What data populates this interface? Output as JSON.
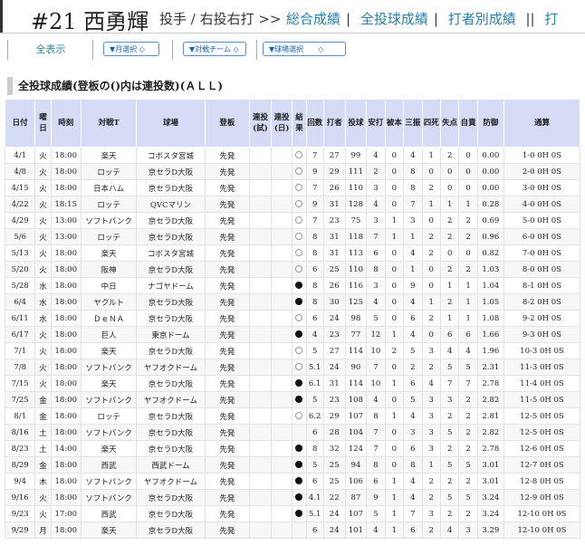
{
  "header": {
    "title": "#21 西勇輝",
    "meta": "投手 / 右投右打 >>",
    "links": [
      "総合成績",
      "全投球成績",
      "打者別成績",
      "打"
    ]
  },
  "filters": {
    "all_label": "全表示",
    "month": "▼月選択 ◇",
    "team": "▼対戦チーム ◇",
    "stadium": "▼球場選択　　◇"
  },
  "section_title": "全投球成績(登板の()内は連投数)(ＡＬＬ)",
  "table": {
    "headers": [
      "日付",
      "曜日",
      "時刻",
      "対戦T",
      "球場",
      "登板",
      "連投(試)",
      "連投(日)",
      "結果",
      "回数",
      "打者",
      "投球",
      "安打",
      "被本",
      "三振",
      "四死",
      "失点",
      "自責",
      "防御",
      "通算"
    ],
    "rows": [
      [
        "4/1",
        "火",
        "18:00",
        "楽天",
        "コボスタ宮城",
        "先発",
        "",
        "",
        "win",
        "7",
        "27",
        "99",
        "4",
        "0",
        "4",
        "1",
        "2",
        "0",
        "0.00",
        "1-0 0H 0S"
      ],
      [
        "4/8",
        "火",
        "18:00",
        "ロッテ",
        "京セラD大阪",
        "先発",
        "",
        "",
        "win",
        "9",
        "29",
        "111",
        "2",
        "0",
        "8",
        "0",
        "0",
        "0",
        "0.00",
        "2-0 0H 0S"
      ],
      [
        "4/15",
        "火",
        "18:00",
        "日本ハム",
        "京セラD大阪",
        "先発",
        "",
        "",
        "win",
        "7",
        "26",
        "110",
        "3",
        "0",
        "8",
        "2",
        "0",
        "0",
        "0.00",
        "3-0 0H 0S"
      ],
      [
        "4/22",
        "火",
        "18:15",
        "ロッテ",
        "QVCマリン",
        "先発",
        "",
        "",
        "win",
        "9",
        "31",
        "128",
        "4",
        "0",
        "7",
        "1",
        "1",
        "1",
        "0.28",
        "4-0 0H 0S"
      ],
      [
        "4/29",
        "火",
        "13:00",
        "ソフトバンク",
        "京セラD大阪",
        "先発",
        "",
        "",
        "win",
        "7",
        "23",
        "75",
        "3",
        "1",
        "3",
        "0",
        "2",
        "2",
        "0.69",
        "5-0 0H 0S"
      ],
      [
        "5/6",
        "火",
        "13:00",
        "ロッテ",
        "京セラD大阪",
        "先発",
        "",
        "",
        "win",
        "8",
        "31",
        "118",
        "7",
        "1",
        "1",
        "2",
        "2",
        "2",
        "0.96",
        "6-0 0H 0S"
      ],
      [
        "5/13",
        "火",
        "18:00",
        "楽天",
        "コボスタ宮城",
        "先発",
        "",
        "",
        "win",
        "8",
        "31",
        "113",
        "6",
        "0",
        "4",
        "2",
        "0",
        "0",
        "0.82",
        "7-0 0H 0S"
      ],
      [
        "5/20",
        "火",
        "18:00",
        "阪神",
        "京セラD大阪",
        "先発",
        "",
        "",
        "win",
        "6",
        "25",
        "110",
        "8",
        "0",
        "1",
        "0",
        "2",
        "2",
        "1.03",
        "8-0 0H 0S"
      ],
      [
        "5/28",
        "水",
        "18:00",
        "中日",
        "ナゴヤドーム",
        "先発",
        "",
        "",
        "loss",
        "8",
        "26",
        "116",
        "3",
        "0",
        "9",
        "0",
        "1",
        "1",
        "1.04",
        "8-1 0H 0S"
      ],
      [
        "6/4",
        "水",
        "18:00",
        "ヤクルト",
        "京セラD大阪",
        "先発",
        "",
        "",
        "loss",
        "8",
        "30",
        "125",
        "4",
        "0",
        "4",
        "1",
        "2",
        "1",
        "1.05",
        "8-2 0H 0S"
      ],
      [
        "6/11",
        "水",
        "18:00",
        "ＤｅＮＡ",
        "京セラD大阪",
        "先発",
        "",
        "",
        "win",
        "6",
        "24",
        "98",
        "5",
        "0",
        "6",
        "2",
        "1",
        "1",
        "1.08",
        "9-2 0H 0S"
      ],
      [
        "6/17",
        "火",
        "18:00",
        "巨人",
        "東京ドーム",
        "先発",
        "",
        "",
        "loss",
        "4",
        "23",
        "77",
        "12",
        "1",
        "4",
        "0",
        "6",
        "6",
        "1.66",
        "9-3 0H 0S"
      ],
      [
        "7/1",
        "火",
        "18:00",
        "楽天",
        "京セラD大阪",
        "先発",
        "",
        "",
        "win",
        "5",
        "27",
        "114",
        "10",
        "2",
        "5",
        "3",
        "4",
        "4",
        "1.96",
        "10-3 0H 0S"
      ],
      [
        "7/8",
        "火",
        "18:00",
        "ソフトバンク",
        "ヤフオクドーム",
        "先発",
        "",
        "",
        "win",
        "5.1",
        "24",
        "90",
        "7",
        "0",
        "2",
        "2",
        "5",
        "5",
        "2.31",
        "11-3 0H 0S"
      ],
      [
        "7/15",
        "火",
        "18:00",
        "楽天",
        "京セラD大阪",
        "先発",
        "",
        "",
        "loss",
        "6.1",
        "31",
        "114",
        "10",
        "1",
        "6",
        "4",
        "7",
        "7",
        "2.78",
        "11-4 0H 0S"
      ],
      [
        "7/25",
        "金",
        "18:00",
        "ソフトバンク",
        "ヤフオクドーム",
        "先発",
        "",
        "",
        "loss",
        "5",
        "23",
        "108",
        "4",
        "0",
        "5",
        "3",
        "3",
        "2",
        "2.82",
        "11-5 0H 0S"
      ],
      [
        "8/1",
        "金",
        "18:00",
        "ロッテ",
        "京セラD大阪",
        "先発",
        "",
        "",
        "win",
        "6.2",
        "29",
        "107",
        "8",
        "1",
        "4",
        "3",
        "2",
        "2",
        "2.81",
        "12-5 0H 0S"
      ],
      [
        "8/16",
        "土",
        "18:00",
        "ソフトバンク",
        "京セラD大阪",
        "先発",
        "",
        "",
        "",
        "6",
        "28",
        "104",
        "7",
        "0",
        "3",
        "3",
        "5",
        "2",
        "2.82",
        "12-5 0H 0S"
      ],
      [
        "8/23",
        "土",
        "14:00",
        "楽天",
        "京セラD大阪",
        "先発",
        "",
        "",
        "loss",
        "8",
        "32",
        "124",
        "7",
        "0",
        "6",
        "3",
        "2",
        "2",
        "2.78",
        "12-6 0H 0S"
      ],
      [
        "8/29",
        "金",
        "18:00",
        "西武",
        "西武ドーム",
        "先発",
        "",
        "",
        "loss",
        "5",
        "25",
        "94",
        "8",
        "0",
        "8",
        "1",
        "5",
        "5",
        "3.01",
        "12-7 0H 0S"
      ],
      [
        "9/4",
        "木",
        "18:00",
        "ソフトバンク",
        "ヤフオクドーム",
        "先発",
        "",
        "",
        "loss",
        "6",
        "25",
        "106",
        "6",
        "1",
        "4",
        "2",
        "2",
        "2",
        "3.01",
        "12-8 0H 0S"
      ],
      [
        "9/16",
        "火",
        "18:00",
        "ソフトバンク",
        "京セラD大阪",
        "先発",
        "",
        "",
        "loss",
        "4.1",
        "22",
        "87",
        "9",
        "1",
        "4",
        "2",
        "5",
        "5",
        "3.24",
        "12-9 0H 0S"
      ],
      [
        "9/23",
        "火",
        "17:00",
        "西武",
        "京セラD大阪",
        "先発",
        "",
        "",
        "loss",
        "5.1",
        "24",
        "107",
        "5",
        "1",
        "7",
        "3",
        "2",
        "2",
        "3.24",
        "12-10 0H 0S"
      ],
      [
        "9/29",
        "月",
        "18:00",
        "楽天",
        "京セラD大阪",
        "先発",
        "",
        "",
        "",
        "6",
        "24",
        "101",
        "4",
        "1",
        "6",
        "2",
        "4",
        "3",
        "3.29",
        "12-10 0H 0S"
      ]
    ]
  }
}
